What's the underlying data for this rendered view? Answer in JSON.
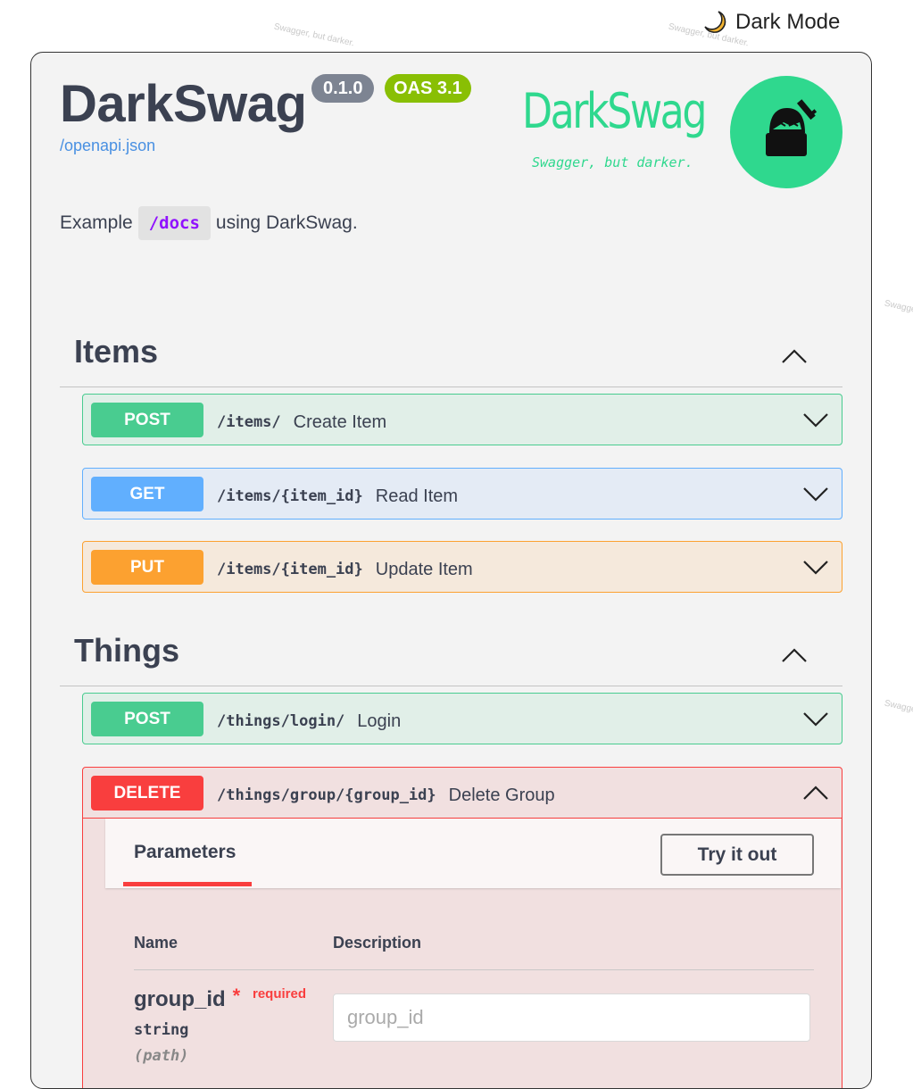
{
  "dark_mode_label": "Dark Mode",
  "watermark": "Swagger, but darker.",
  "info": {
    "title": "DarkSwag",
    "version": "0.1.0",
    "oas": "OAS 3.1",
    "spec_link": "/openapi.json",
    "desc_before": "Example",
    "desc_code": "/docs",
    "desc_after": "using DarkSwag."
  },
  "brand": {
    "name": "DarkSwag",
    "tagline": "Swagger, but darker."
  },
  "tags": [
    {
      "name": "Items",
      "ops": [
        {
          "method": "POST",
          "path": "/items/",
          "summary": "Create Item"
        },
        {
          "method": "GET",
          "path": "/items/{item_id}",
          "summary": "Read Item"
        },
        {
          "method": "PUT",
          "path": "/items/{item_id}",
          "summary": "Update Item"
        }
      ]
    },
    {
      "name": "Things",
      "ops": [
        {
          "method": "POST",
          "path": "/things/login/",
          "summary": "Login"
        },
        {
          "method": "DELETE",
          "path": "/things/group/{group_id}",
          "summary": "Delete Group"
        }
      ]
    }
  ],
  "expanded": {
    "parameters_label": "Parameters",
    "try_label": "Try it out",
    "col_name": "Name",
    "col_desc": "Description",
    "param": {
      "name": "group_id",
      "required_star": "*",
      "required": "required",
      "type": "string",
      "location": "(path)",
      "placeholder": "group_id"
    }
  },
  "colors": {
    "post": "#49cc90",
    "get": "#61affe",
    "put": "#fca130",
    "delete": "#f93e3e",
    "brand": "#2fd88e",
    "oas": "#89bf04",
    "version": "#7d8492"
  },
  "icons": [
    "moon-icon",
    "ninja-logo-icon",
    "chevron-up-icon",
    "chevron-down-icon"
  ]
}
